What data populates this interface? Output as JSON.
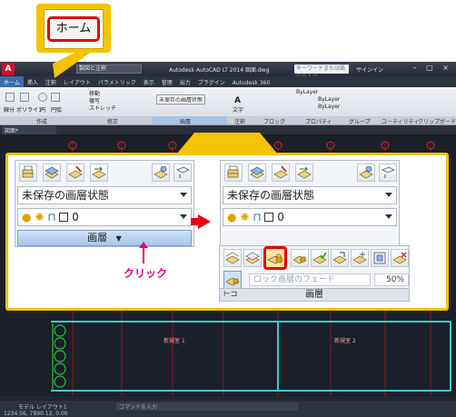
{
  "home_callout": {
    "label": "ホーム"
  },
  "app": {
    "logo": "A",
    "workspace": "製図と注釈",
    "title": "Autodesk AutoCAD LT 2014   図面.dwg",
    "search_placeholder": "キーワードまたは語句を入力",
    "signin": "サインイン",
    "window_buttons": "– □ ×"
  },
  "menubar": [
    "ホーム",
    "挿入",
    "注釈",
    "レイアウト",
    "パラメトリック",
    "表示",
    "管理",
    "出力",
    "プラグイン",
    "Autodesk 360"
  ],
  "ribbon": {
    "draw_tools": [
      "線分",
      "ポリライン",
      "円",
      "円弧"
    ],
    "modify_tools": [
      "移動",
      "複写",
      "ストレッチ"
    ],
    "layer_combo": "未保存の画層状態",
    "bylayer": "ByLayer",
    "text_tool": "文字",
    "panels": [
      "作成",
      "修正",
      "画層",
      "注釈",
      "ブロック",
      "プロパティ",
      "グループ",
      "ユーティリティ",
      "クリップボード"
    ]
  },
  "doc_tab": "図面*",
  "status": {
    "command_placeholder": "コマンドを入力",
    "layout_tabs": "モデル  レイアウト1",
    "coords": "1234.56, 7890.12, 0.00"
  },
  "drawing_labels": {
    "left_label": "新規室 1",
    "right_label": "新規室 2"
  },
  "left_panel": {
    "state_combo": "未保存の画層状態",
    "layer_value": "0",
    "footer_label": "画層",
    "footer_arrow": "▼"
  },
  "right_panel": {
    "state_combo": "未保存の画層状態",
    "layer_value": "0"
  },
  "extended_panel": {
    "fade_label": "ロック画層のフェード",
    "fade_percent": "50%",
    "footer_label": "画層",
    "pin": "⊢⊐"
  },
  "annotation": {
    "click_label": "クリック"
  },
  "colors": {
    "callout_yellow": "#f4c400",
    "highlight_red": "#e60000",
    "click_pink": "#e4007f",
    "ribbon_blue": "#a9c6ec"
  }
}
